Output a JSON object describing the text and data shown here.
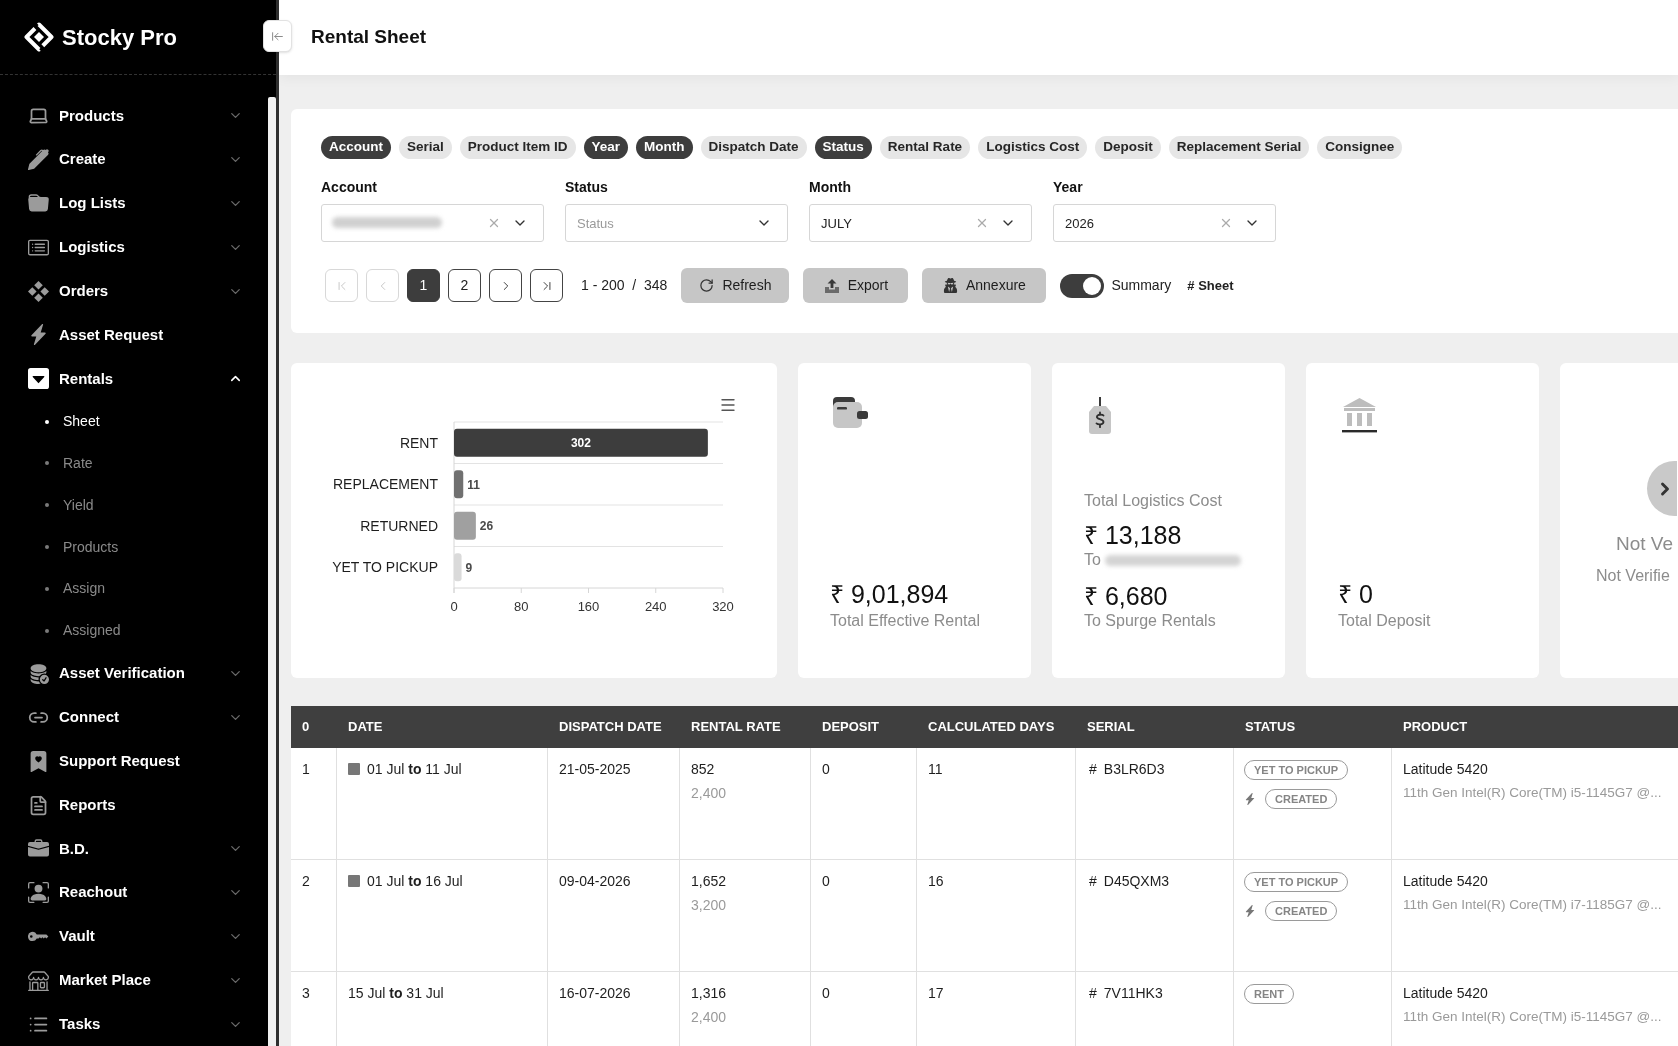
{
  "sidebar": {
    "brand": "Stocky Pro",
    "items": [
      {
        "label": "Products",
        "kind": "group",
        "expanded": false
      },
      {
        "label": "Create",
        "kind": "group",
        "expanded": false
      },
      {
        "label": "Log Lists",
        "kind": "group",
        "expanded": false
      },
      {
        "label": "Logistics",
        "kind": "group",
        "expanded": false
      },
      {
        "label": "Orders",
        "kind": "group",
        "expanded": false
      },
      {
        "label": "Asset Request",
        "kind": "link"
      },
      {
        "label": "Rentals",
        "kind": "group",
        "expanded": true,
        "children": [
          {
            "label": "Sheet",
            "selected": true
          },
          {
            "label": "Rate",
            "selected": false
          },
          {
            "label": "Yield",
            "selected": false
          },
          {
            "label": "Products",
            "selected": false
          },
          {
            "label": "Assign",
            "selected": false
          },
          {
            "label": "Assigned",
            "selected": false
          }
        ]
      },
      {
        "label": "Asset Verification",
        "kind": "group",
        "expanded": false
      },
      {
        "label": "Connect",
        "kind": "group",
        "expanded": false
      },
      {
        "label": "Support Request",
        "kind": "link"
      },
      {
        "label": "Reports",
        "kind": "link"
      },
      {
        "label": "B.D.",
        "kind": "group",
        "expanded": false
      },
      {
        "label": "Reachout",
        "kind": "group",
        "expanded": false
      },
      {
        "label": "Vault",
        "kind": "group",
        "expanded": false
      },
      {
        "label": "Market Place",
        "kind": "group",
        "expanded": false
      },
      {
        "label": "Tasks",
        "kind": "group",
        "expanded": false
      }
    ]
  },
  "header": {
    "title": "Rental Sheet"
  },
  "filters": {
    "chips": [
      {
        "label": "Account",
        "selected": true
      },
      {
        "label": "Serial",
        "selected": false
      },
      {
        "label": "Product Item ID",
        "selected": false
      },
      {
        "label": "Year",
        "selected": true
      },
      {
        "label": "Month",
        "selected": true
      },
      {
        "label": "Dispatch Date",
        "selected": false
      },
      {
        "label": "Status",
        "selected": true
      },
      {
        "label": "Rental Rate",
        "selected": false
      },
      {
        "label": "Logistics Cost",
        "selected": false
      },
      {
        "label": "Deposit",
        "selected": false
      },
      {
        "label": "Replacement Serial",
        "selected": false
      },
      {
        "label": "Consignee",
        "selected": false
      }
    ],
    "fields": [
      {
        "label": "Account",
        "redacted": true,
        "clearable": true
      },
      {
        "label": "Status",
        "placeholder": "Status",
        "clearable": false
      },
      {
        "label": "Month",
        "value": "JULY",
        "clearable": true
      },
      {
        "label": "Year",
        "value": "2026",
        "clearable": true
      }
    ],
    "pagination": {
      "buttons": [
        {
          "kind": "first",
          "disabled": true
        },
        {
          "kind": "prev",
          "disabled": true
        },
        {
          "kind": "page",
          "label": "1",
          "selected": true
        },
        {
          "kind": "page",
          "label": "2",
          "selected": false
        },
        {
          "kind": "next",
          "disabled": false
        },
        {
          "kind": "last",
          "disabled": false
        }
      ],
      "range": "1 - 200  /  348"
    },
    "actions": [
      {
        "kind": "refresh",
        "label": "Refresh"
      },
      {
        "kind": "export",
        "label": "Export"
      },
      {
        "kind": "annexure",
        "label": "Annexure"
      }
    ],
    "toggle": {
      "label": "Summary",
      "on": true
    },
    "sheet_label": "# Sheet"
  },
  "summary": {
    "chart_data": {
      "type": "bar",
      "orientation": "horizontal",
      "categories": [
        "RENT",
        "REPLACEMENT",
        "RETURNED",
        "YET TO PICKUP"
      ],
      "values": [
        302,
        11,
        26,
        9
      ],
      "xlim": [
        0,
        320
      ],
      "xticks": [
        0,
        80,
        160,
        240,
        320
      ],
      "data_labels": true
    },
    "cards": [
      {
        "kind": "rental",
        "amount": "₹ 9,01,894",
        "caption": "Total Effective Rental"
      },
      {
        "kind": "logistics",
        "title": "Total Logistics Cost",
        "entries": [
          {
            "amount": "₹ 13,188",
            "caption": "To",
            "redacted": true
          },
          {
            "amount": "₹ 6,680",
            "caption": "To Spurge Rentals",
            "redacted": false
          }
        ]
      },
      {
        "kind": "deposit",
        "amount": "₹ 0",
        "caption": "Total Deposit"
      },
      {
        "kind": "verification",
        "title": "Not Ve",
        "caption": "Not Verifie"
      }
    ]
  },
  "table": {
    "columns": [
      "0",
      "DATE",
      "DISPATCH DATE",
      "RENTAL RATE",
      "DEPOSIT",
      "CALCULATED DAYS",
      "SERIAL",
      "STATUS",
      "PRODUCT"
    ],
    "rows": [
      {
        "index": "1",
        "marked": true,
        "date": "01 Jul **to** 11 Jul",
        "dispatch_date": "21-05-2025",
        "rate": "852",
        "base_rate": "2,400",
        "deposit": "0",
        "days": "11",
        "serial_prefix": "#",
        "serial": "B3LR6D3",
        "statuses": [
          {
            "label": "YET TO PICKUP",
            "bolt": false
          },
          {
            "label": "CREATED",
            "bolt": true
          }
        ],
        "product": "Latitude 5420",
        "spec": "11th Gen Intel(R) Core(TM) i5-1145G7 @..."
      },
      {
        "index": "2",
        "marked": true,
        "date": "01 Jul **to** 16 Jul",
        "dispatch_date": "09-04-2026",
        "rate": "1,652",
        "base_rate": "3,200",
        "deposit": "0",
        "days": "16",
        "serial_prefix": "#",
        "serial": "D45QXM3",
        "statuses": [
          {
            "label": "YET TO PICKUP",
            "bolt": false
          },
          {
            "label": "CREATED",
            "bolt": true
          }
        ],
        "product": "Latitude 5420",
        "spec": "11th Gen Intel(R) Core(TM) i7-1185G7 @..."
      },
      {
        "index": "3",
        "marked": false,
        "date": "15 Jul **to** 31 Jul",
        "dispatch_date": "16-07-2026",
        "rate": "1,316",
        "base_rate": "2,400",
        "deposit": "0",
        "days": "17",
        "serial_prefix": "#",
        "serial": "7V11HK3",
        "statuses": [
          {
            "label": "RENT",
            "bolt": false
          }
        ],
        "product": "Latitude 5420",
        "spec": "11th Gen Intel(R) Core(TM) i5-1145G7 @..."
      }
    ]
  }
}
